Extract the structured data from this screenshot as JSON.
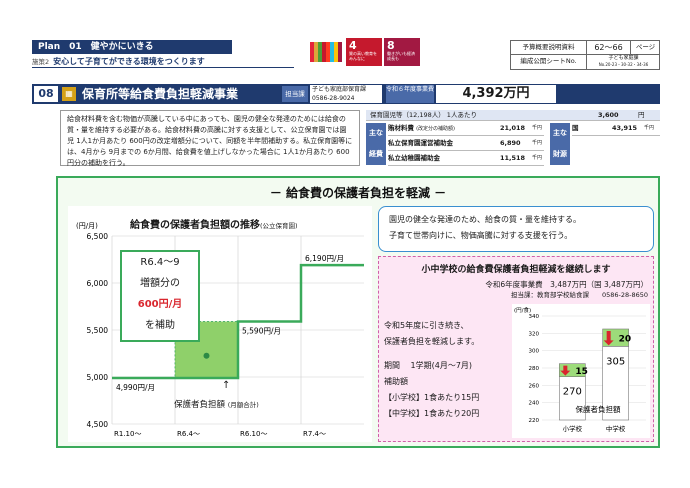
{
  "header": {
    "plan_label": "Plan　01　健やかにいきる",
    "policy_tag": "施策2",
    "policy_text": "安心して子育てができる環境をつくります",
    "sdgs": [
      {
        "num": "4",
        "text": "質の高い教育をみんなに",
        "color": "#c5192d"
      },
      {
        "num": "8",
        "text": "働きがいも経済成長も",
        "color": "#a21942"
      }
    ],
    "ref": {
      "label1": "予算概要説明資料",
      "pages": "62～66",
      "page_unit": "ページ",
      "label2": "編成公開シートNo.",
      "sheet_title": "子ども家庭課",
      "sheet_nums": "No.20-23・30-32・34-36"
    }
  },
  "project": {
    "number": "08",
    "icon": "books-icon",
    "title": "保育所等給食費負担軽減事業",
    "tantou_label": "担当課",
    "dept": "子ども家庭部保育課",
    "phone": "0586-28-9024",
    "budget_label": "令和６年度事業費",
    "budget_value": "4,392万円"
  },
  "description": "給食材料費を含む物価が高騰している中にあっても、園児の健全な発達のためには給食の質・量を維持する必要がある。給食材料費の高騰に対する支援として、公立保育園では園児 1人1か月あたり 600円の改定増額分について、同額を半年間補助する。私立保育園等には、4月から 9月までの 6か月間、給食費を値上げしなかった場合に 1人1か月あたり 600円分の補助を行う。",
  "finance": {
    "head_label": "保育園児等（12,198人） 1人あたり",
    "head_value": "3,600",
    "head_unit": "円",
    "left_label": "主な経費",
    "items": [
      {
        "label": "賄材料費",
        "note": "(改定分の補助額)",
        "value": "21,018",
        "unit": "千円"
      },
      {
        "label": "私立保育園運営補助金",
        "note": "",
        "value": "6,890",
        "unit": "千円"
      },
      {
        "label": "私立幼稚園補助金",
        "note": "",
        "value": "11,518",
        "unit": "千円"
      }
    ],
    "source_label": "主な財源",
    "sources": [
      {
        "label": "国",
        "value": "43,915",
        "unit": "千円"
      }
    ]
  },
  "main_title": "－ 給食費の保護者負担を軽減 －",
  "chart_left": {
    "title": "給食費の保護者負担額の推移",
    "subtitle": "(公立保育園)",
    "note_lines": [
      "R6.4～9",
      "増額分の",
      "600円/月",
      "を補助"
    ],
    "arrow": "↑",
    "burden_label": "保護者負担額",
    "burden_sub": "(月額合計)"
  },
  "chart_data": [
    {
      "type": "line",
      "title": "給食費の保護者負担額の推移",
      "subtitle": "(公立保育園)",
      "ylabel": "(円/月)",
      "xlabel": "",
      "ylim": [
        4500,
        6500
      ],
      "yticks": [
        "6,500",
        "6,000",
        "5,500",
        "5,000",
        "4,500"
      ],
      "ytick_values": [
        6500,
        6000,
        5500,
        5000,
        4500
      ],
      "x_ticks": [
        "R1.10～",
        "R6.4～",
        "R6.10～",
        "R7.4～"
      ],
      "series": [
        {
          "values": [
            4990,
            4990,
            5590,
            6190
          ]
        }
      ],
      "data_labels": [
        "4,990円/月",
        "5,590円/月",
        "6,190円/月"
      ],
      "grid": true,
      "colors": {
        "line": "#3aaa5a",
        "fill": "#8fd06a"
      }
    },
    {
      "type": "bar",
      "ylabel": "(円/食)",
      "categories": [
        "小学校",
        "中学校"
      ],
      "series": [
        {
          "name": "保護者負担額",
          "values": [
            270,
            305
          ]
        }
      ],
      "subsidy_values": [
        15,
        20
      ],
      "ylim": [
        220,
        340
      ],
      "yticks": [
        "340",
        "320",
        "300",
        "280",
        "260",
        "240",
        "220"
      ],
      "ytick_values": [
        340,
        320,
        300,
        280,
        260,
        240,
        220
      ],
      "colors": {
        "bar": "#ffffff",
        "subsidy": "#9ddc7a",
        "arrow": "#d9262e"
      }
    }
  ],
  "bubble": {
    "line1": "園児の健全な発達のため、給食の質・量を維持する。",
    "line2": "子育て世帯向けに、物価高騰に対する支援を行う。"
  },
  "school": {
    "title": "小中学校の給食費保護者負担軽減を継続します",
    "budget": "令和6年度事業費　3,487万円（国 3,487万円）",
    "contact": "担当課：教育部学校給食課　　0586-28-8650",
    "lines": [
      "令和5年度に引き続き、",
      "保護者負担を軽減します。"
    ],
    "period": "期間　 1学期(4月～7月)",
    "subsidy_label": "補助額",
    "elementary": "【小学校】1食あたり15円",
    "junior": "【中学校】1食あたり20円",
    "bar_caption": "保護者負担額"
  }
}
